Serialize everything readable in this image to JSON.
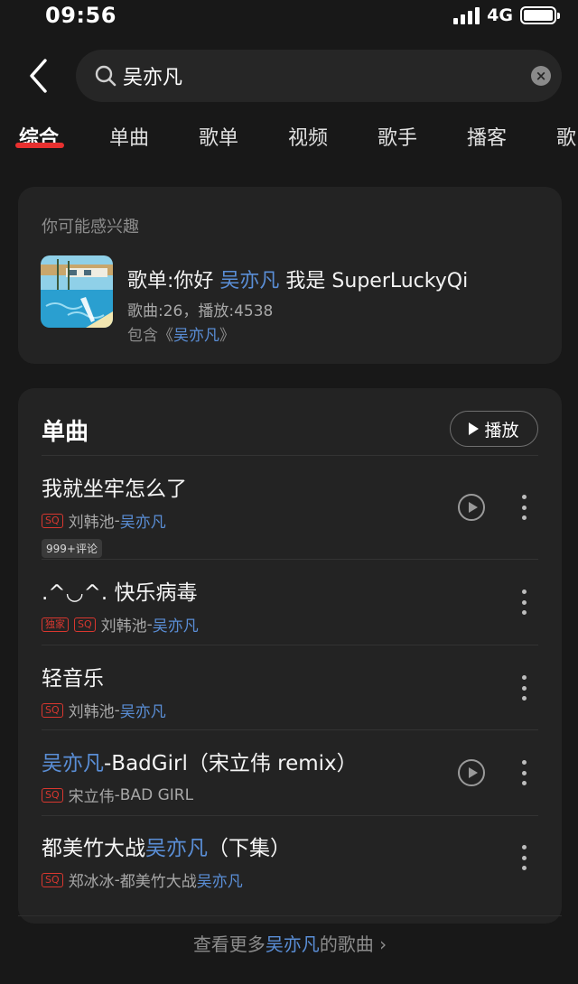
{
  "status": {
    "time": "09:56",
    "network": "4G"
  },
  "search": {
    "query": "吴亦凡"
  },
  "tabs": [
    "综合",
    "单曲",
    "歌单",
    "视频",
    "歌手",
    "播客",
    "歌"
  ],
  "active_tab": "综合",
  "interest": {
    "caption": "你可能感兴趣",
    "title_prefix": "歌单:你好 ",
    "title_highlight": "吴亦凡",
    "title_suffix": " 我是 SuperLuckyQi",
    "meta": "歌曲:26，播放:4538",
    "contains_prefix": "包含《",
    "contains_highlight": "吴亦凡",
    "contains_suffix": "》"
  },
  "songs_section": {
    "heading": "单曲",
    "play_all": "播放",
    "items": [
      {
        "title_pre": "我就坐牢怎么了",
        "title_hl": "",
        "title_post": "",
        "badges": [
          "SQ"
        ],
        "artist": "刘韩池",
        "sep": " - ",
        "album_pre": "",
        "album_hl": "吴亦凡",
        "comments": "999+评论",
        "has_mv": true
      },
      {
        "title_pre": ".^◡^. 快乐病毒",
        "title_hl": "",
        "title_post": "",
        "badges": [
          "独家",
          "SQ"
        ],
        "artist": "刘韩池",
        "sep": " - ",
        "album_pre": "",
        "album_hl": "吴亦凡",
        "comments": "",
        "has_mv": false
      },
      {
        "title_pre": "轻音乐",
        "title_hl": "",
        "title_post": "",
        "badges": [
          "SQ"
        ],
        "artist": "刘韩池",
        "sep": " - ",
        "album_pre": "",
        "album_hl": "吴亦凡",
        "comments": "",
        "has_mv": false
      },
      {
        "title_pre": "",
        "title_hl": "吴亦凡",
        "title_post": "-BadGirl（宋立伟 remix）",
        "badges": [
          "SQ"
        ],
        "artist": "宋立伟",
        "sep": " - ",
        "album_pre": "BAD GIRL",
        "album_hl": "",
        "comments": "",
        "has_mv": true
      },
      {
        "title_pre": "都美竹大战",
        "title_hl": "吴亦凡",
        "title_post": "（下集）",
        "badges": [
          "SQ"
        ],
        "artist": "郑冰冰",
        "sep": " - ",
        "album_pre": "都美竹大战",
        "album_hl": "吴亦凡",
        "comments": "",
        "has_mv": false
      }
    ],
    "more_prefix": "查看更多",
    "more_highlight": "吴亦凡",
    "more_suffix": "的歌曲 ›"
  },
  "colors": {
    "highlight": "#5a8ed6",
    "accent": "#e8302f",
    "background": "#181818",
    "card": "#232323"
  },
  "icons": [
    "back-arrow-icon",
    "search-icon",
    "clear-icon",
    "play-icon",
    "mv-icon",
    "more-icon"
  ]
}
